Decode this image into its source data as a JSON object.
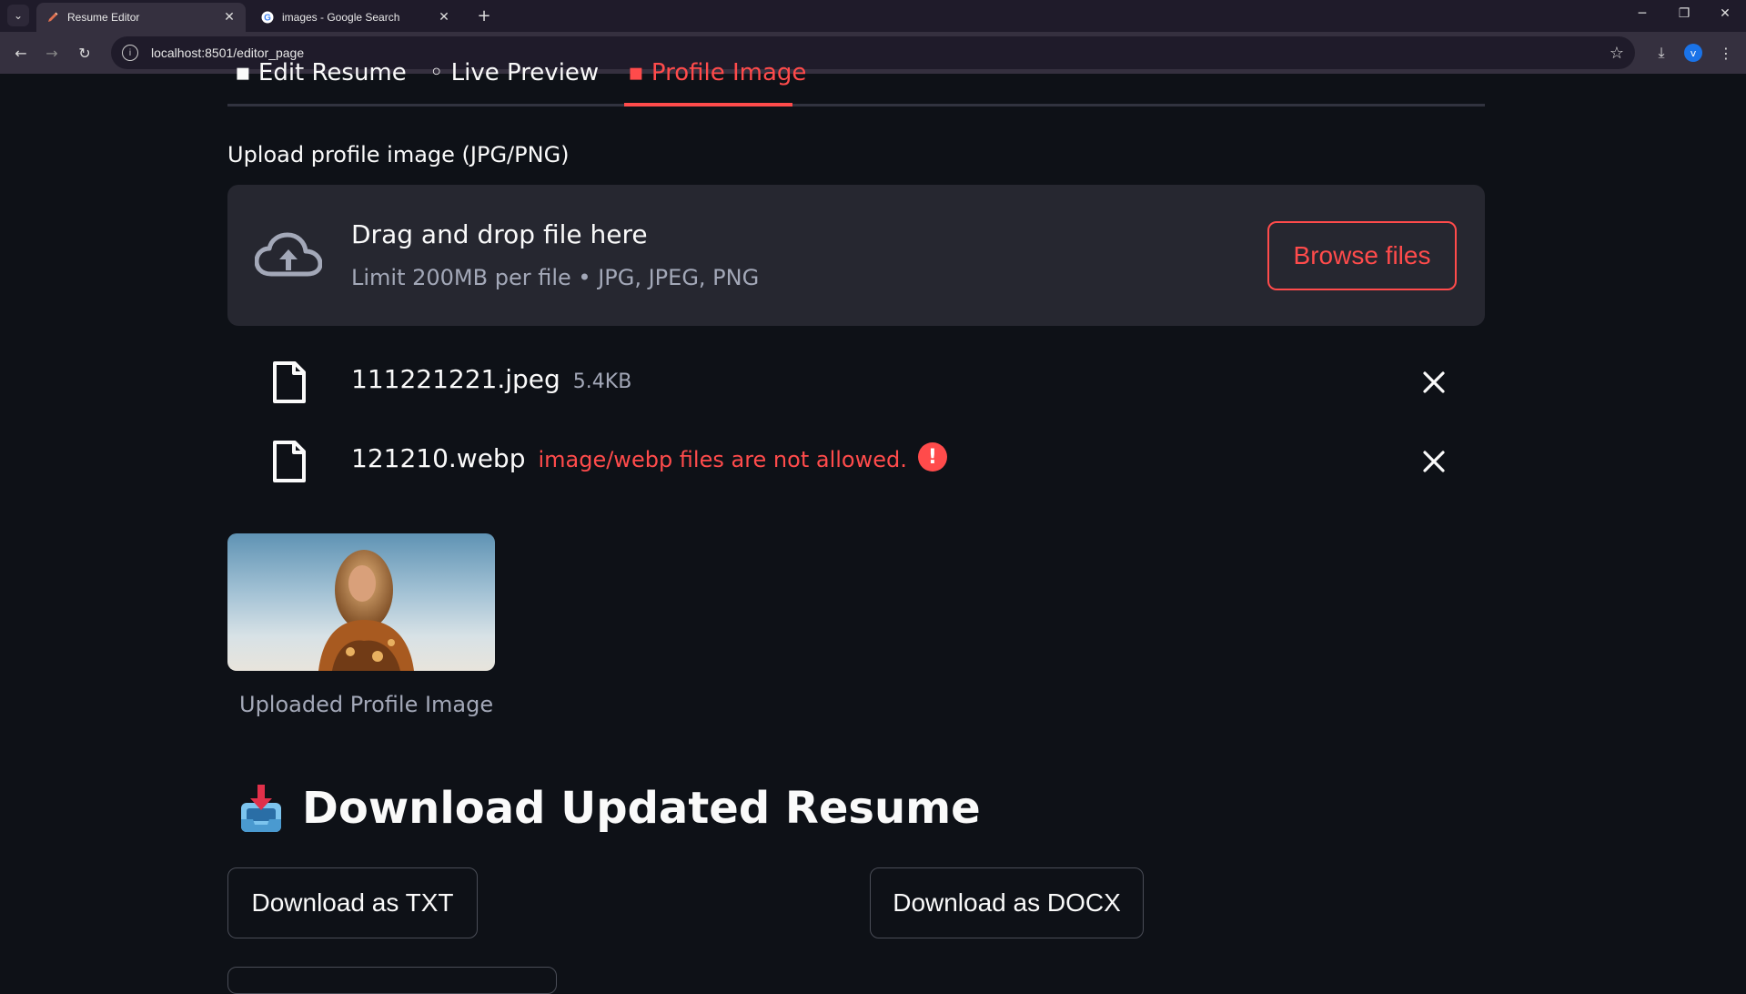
{
  "browser": {
    "tabs": [
      {
        "title": "Resume Editor",
        "icon": "pencil-icon",
        "active": true
      },
      {
        "title": "images - Google Search",
        "icon": "google-icon",
        "active": false
      }
    ],
    "url": "localhost:8501/editor_page",
    "profile_initial": "v"
  },
  "app": {
    "tabs": [
      "Edit Resume",
      "Live Preview",
      "Profile Image"
    ],
    "active_tab": "Profile Image",
    "uploader": {
      "label": "Upload profile image (JPG/PNG)",
      "drag_text": "Drag and drop file here",
      "limit_text": "Limit 200MB per file • JPG, JPEG, PNG",
      "browse_label": "Browse files",
      "files": [
        {
          "name": "111221221.jpeg",
          "size": "5.4KB",
          "error": ""
        },
        {
          "name": "121210.webp",
          "size": "",
          "error": "image/webp files are not allowed."
        }
      ]
    },
    "image_caption": "Uploaded Profile Image",
    "download": {
      "heading": "Download Updated Resume",
      "heading_icon": "inbox-tray-icon",
      "txt_label": "Download as TXT",
      "docx_label": "Download as DOCX"
    }
  },
  "colors": {
    "background": "#0e1117",
    "accent": "#ff4b4b",
    "panel": "#262730",
    "muted_text": "#a3a8b8"
  }
}
